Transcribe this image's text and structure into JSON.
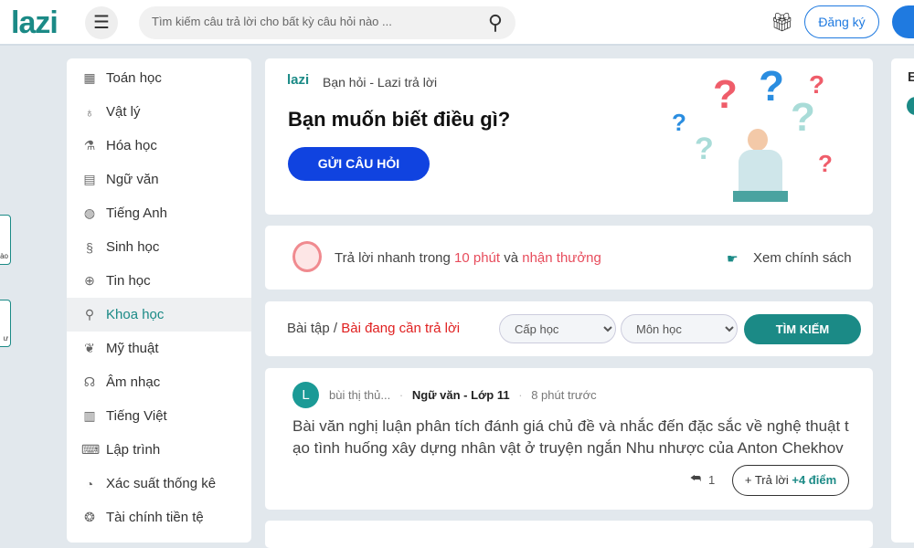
{
  "header": {
    "logo": "lazi",
    "search_placeholder": "Tìm kiếm câu trả lời cho bất kỳ câu hỏi nào ...",
    "signup": "Đăng ký"
  },
  "sidebar": {
    "items": [
      {
        "label": "Toán học",
        "icon": "calculator-icon",
        "glyph": "▦"
      },
      {
        "label": "Vật lý",
        "icon": "bulb-icon",
        "glyph": "♁"
      },
      {
        "label": "Hóa học",
        "icon": "flask-icon",
        "glyph": "⚗"
      },
      {
        "label": "Ngữ văn",
        "icon": "book-icon",
        "glyph": "▤"
      },
      {
        "label": "Tiếng Anh",
        "icon": "globe-icon",
        "glyph": "◍"
      },
      {
        "label": "Sinh học",
        "icon": "dna-icon",
        "glyph": "§"
      },
      {
        "label": "Tin học",
        "icon": "network-icon",
        "glyph": "⊕"
      },
      {
        "label": "Khoa học",
        "icon": "telescope-icon",
        "glyph": "⚲"
      },
      {
        "label": "Mỹ thuật",
        "icon": "palette-icon",
        "glyph": "❦"
      },
      {
        "label": "Âm nhạc",
        "icon": "headphones-icon",
        "glyph": "☊"
      },
      {
        "label": "Tiếng Việt",
        "icon": "book-open-icon",
        "glyph": "▥"
      },
      {
        "label": "Lập trình",
        "icon": "code-icon",
        "glyph": "⌨"
      },
      {
        "label": "Xác suất thống kê",
        "icon": "chart-icon",
        "glyph": "◔"
      },
      {
        "label": "Tài chính tiền tệ",
        "icon": "money-icon",
        "glyph": "❂"
      }
    ],
    "active": "Khoa học"
  },
  "hero": {
    "brand": "lazi",
    "tagline": "Bạn hỏi - Lazi trả lời",
    "title": "Bạn muốn biết điều gì?",
    "button": "GỬI CÂU HỎI"
  },
  "promo": {
    "text1": "Trả lời nhanh trong ",
    "highlight1": "10 phút",
    "text2": " và ",
    "highlight2": "nhận thưởng",
    "policy": "Xem chính sách"
  },
  "filter": {
    "crumb": "Bài tập",
    "sep": " / ",
    "current": "Bài đang cần trả lời",
    "level": "Cấp học",
    "subject": "Môn học",
    "search": "TÌM KIẾM"
  },
  "question": {
    "avatar": "L",
    "user": "bùi thị thủ...",
    "subject": "Ngữ văn - Lớp 11",
    "time": "8 phút trước",
    "text": "Bài văn nghị luận phân tích đánh giá chủ đề và nhắc đến đặc sắc về nghệ thuật tạo tình huống xây dựng nhân vật ở truyện ngắn Nhu nhược của Anton Chekhov",
    "answers": "1",
    "answer_btn": "+ Trả lời",
    "points": "+4 điểm"
  },
  "edge": {
    "left1": "ào",
    "left2": "ư",
    "right": "E"
  },
  "colors": {
    "teal": "#1b8a86",
    "blue": "#1043e0",
    "red": "#e74c5c"
  }
}
